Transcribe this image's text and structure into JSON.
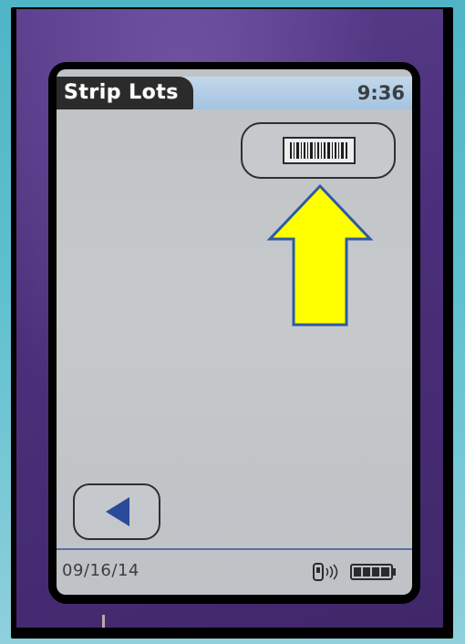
{
  "header": {
    "title": "Strip Lots",
    "time": "9:36"
  },
  "main": {
    "barcode_button_icon": "barcode-icon",
    "annotation_arrow": {
      "icon": "up-arrow-icon",
      "fill": "#ffff00",
      "stroke": "#2e5aa3"
    },
    "back_button_icon": "left-triangle-icon"
  },
  "status_bar": {
    "date": "09/16/14",
    "meter_icon": "meter-wireless-icon",
    "battery_icon": "battery-full-icon"
  },
  "colors": {
    "title_tab": "#2b2b2b",
    "title_bar": "#a5c3e0",
    "screen_bg": "#c4c7c9",
    "accent_blue": "#2a4a9a",
    "device_body": "#4b2f7b",
    "background": "#5fc0cf"
  }
}
